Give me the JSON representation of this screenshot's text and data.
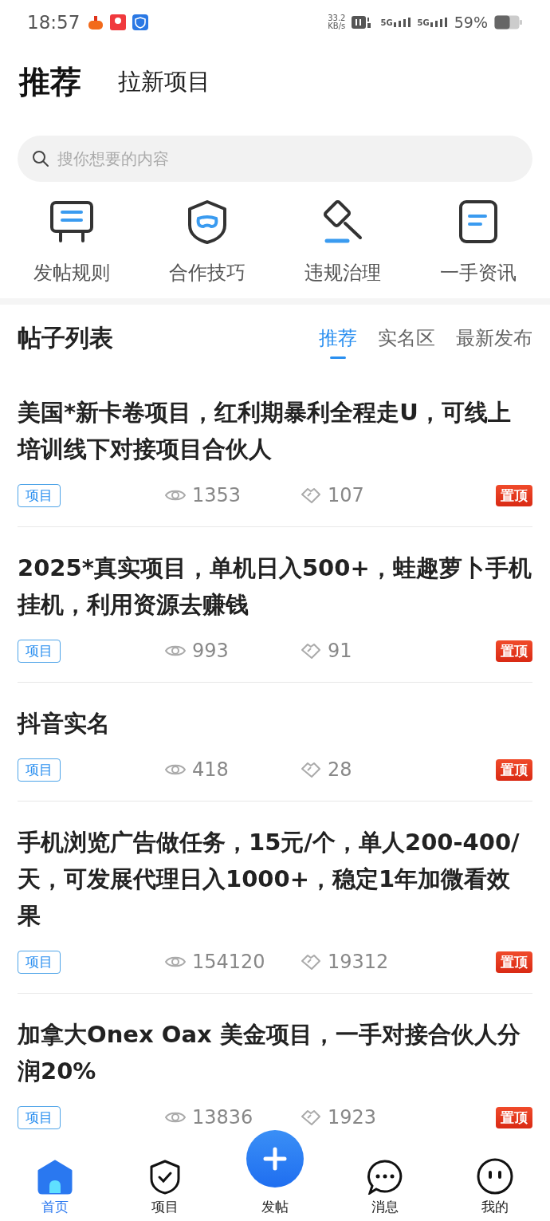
{
  "status_bar": {
    "time": "18:57",
    "speed_value": "33.2",
    "speed_unit": "KB/s",
    "network_labels": [
      "5G",
      "5G"
    ],
    "battery": "59%"
  },
  "header_tabs": [
    {
      "label": "推荐",
      "selected": true
    },
    {
      "label": "拉新项目",
      "selected": false
    }
  ],
  "search": {
    "placeholder": "搜你想要的内容"
  },
  "quick_links": [
    {
      "label": "发帖规则",
      "kind": "board"
    },
    {
      "label": "合作技巧",
      "kind": "shield"
    },
    {
      "label": "违规治理",
      "kind": "gavel"
    },
    {
      "label": "一手资讯",
      "kind": "doc"
    }
  ],
  "post_list": {
    "title": "帖子列表",
    "tabs": [
      {
        "label": "推荐",
        "selected": true
      },
      {
        "label": "实名区",
        "selected": false
      },
      {
        "label": "最新发布",
        "selected": false
      }
    ],
    "posts": [
      {
        "title": "美国*新卡卷项目，红利期暴利全程走U，可线上培训线下对接项目合伙人",
        "tag": "项目",
        "views": "1353",
        "likes": "107",
        "badge": "置顶"
      },
      {
        "title": "2025*真实项目，单机日入500+，蛙趣萝卜手机挂机，利用资源去赚钱",
        "tag": "项目",
        "views": "993",
        "likes": "91",
        "badge": "置顶"
      },
      {
        "title": "抖音实名",
        "tag": "项目",
        "views": "418",
        "likes": "28",
        "badge": "置顶"
      },
      {
        "title": "手机浏览广告做任务，15元/个，单人200-400/天，可发展代理日入1000+，稳定1年加微看效果",
        "tag": "项目",
        "views": "154120",
        "likes": "19312",
        "badge": "置顶"
      },
      {
        "title": "加拿大Onex Oax 美金项目，一手对接合伙人分润20%",
        "tag": "项目",
        "views": "13836",
        "likes": "1923",
        "badge": "置顶"
      }
    ]
  },
  "bottom_nav": [
    {
      "label": "首页",
      "kind": "home",
      "selected": true
    },
    {
      "label": "项目",
      "kind": "shield",
      "selected": false
    },
    {
      "label": "发帖",
      "kind": "post",
      "selected": false
    },
    {
      "label": "消息",
      "kind": "chat",
      "selected": false
    },
    {
      "label": "我的",
      "kind": "face",
      "selected": false
    }
  ]
}
